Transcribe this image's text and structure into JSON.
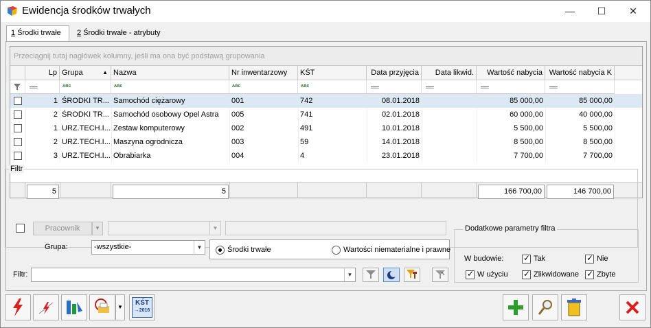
{
  "window": {
    "title": "Ewidencja środków trwałych",
    "minimize": "—",
    "maximize": "☐",
    "close": "✕"
  },
  "tabs": [
    {
      "num": "1",
      "label": " Środki trwałe"
    },
    {
      "num": "2",
      "label": " Środki trwałe - atrybuty"
    }
  ],
  "grid": {
    "group_hint": "Przeciągnij tutaj nagłówek kolumny, jeśli ma ona być podstawą grupowania",
    "columns": [
      "Lp",
      "Grupa",
      "Nazwa",
      "Nr inwentarzowy",
      "KŚT",
      "Data przyjęcia",
      "Data likwid.",
      "Wartość nabycia",
      "Wartość nabycia K"
    ],
    "rows": [
      {
        "lp": "1",
        "grupa": "ŚRODKI TR...",
        "nazwa": "Samochód ciężarowy",
        "nr": "001",
        "kst": "742",
        "data_przyj": "08.01.2018",
        "data_likw": "",
        "wart": "85 000,00",
        "wart_k": "85 000,00"
      },
      {
        "lp": "2",
        "grupa": "ŚRODKI TR...",
        "nazwa": "Samochód osobowy Opel Astra",
        "nr": "005",
        "kst": "741",
        "data_przyj": "02.01.2018",
        "data_likw": "",
        "wart": "60 000,00",
        "wart_k": "40 000,00"
      },
      {
        "lp": "1",
        "grupa": "URZ.TECH.I...",
        "nazwa": "Zestaw komputerowy",
        "nr": "002",
        "kst": "491",
        "data_przyj": "10.01.2018",
        "data_likw": "",
        "wart": "5 500,00",
        "wart_k": "5 500,00"
      },
      {
        "lp": "2",
        "grupa": "URZ.TECH.I...",
        "nazwa": "Maszyna ogrodnicza",
        "nr": "003",
        "kst": "59",
        "data_przyj": "14.01.2018",
        "data_likw": "",
        "wart": "8 500,00",
        "wart_k": "8 500,00"
      },
      {
        "lp": "3",
        "grupa": "URZ.TECH.I...",
        "nazwa": "Obrabiarka",
        "nr": "004",
        "kst": "4",
        "data_przyj": "23.01.2018",
        "data_likw": "",
        "wart": "7 700,00",
        "wart_k": "7 700,00"
      }
    ],
    "summary": {
      "lp": "5",
      "nazwa": "5",
      "wart": "166 700,00",
      "wart_k": "146 700,00"
    },
    "abc_glyph": "ᴀʙc",
    "eq_glyph": "══"
  },
  "filter": {
    "group_title": "Filtr",
    "pracownik_label": "Pracownik",
    "grupa_label": "Grupa:",
    "grupa_value": "-wszystkie-",
    "radio_st": "Środki trwałe",
    "radio_wnip": "Wartości niematerialne i prawne",
    "filtr_label": "Filtr:",
    "extra_title": "Dodatkowe parametry filtra",
    "w_budowie": "W budowie:",
    "tak": "Tak",
    "nie": "Nie",
    "w_uzyciu": "W użyciu",
    "zlikwidowane": "Zlikwidowane",
    "zbyte": "Zbyte"
  },
  "toolbar": {
    "kst_line1": "KŚT",
    "kst_line2": "→2016"
  },
  "colors": {
    "selected_row": "#dde8f5",
    "add_green": "#2aa02a",
    "close_red": "#d81e1e"
  }
}
